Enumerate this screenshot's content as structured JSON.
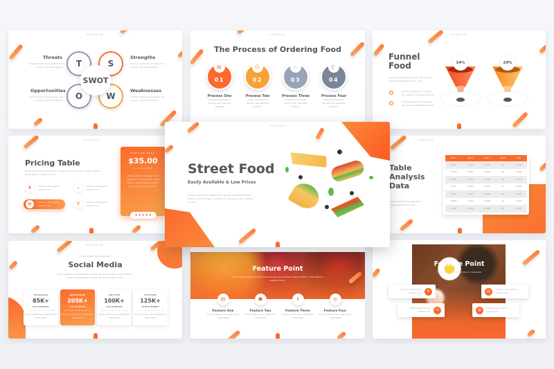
{
  "brand": "FEODLE",
  "lorem_short": "Vivamus elementum semper nisi. Aenean vulputate eleifend.",
  "lorem_long": "Vivamus elementum semper nisi. Aenean vulputate eleifend tellus. Aenean leo ligula, porttitor eu, consequat vitae, eleifend ac, enim.",
  "swot": {
    "center": "SWOT",
    "letters": {
      "t": "T",
      "s": "S",
      "o": "O",
      "w": "W"
    },
    "threats": "Threats",
    "strengths": "Strengths",
    "opportunities": "Opportunities",
    "weaknesses": "Weaknesses",
    "desc": "Vivamus elementum semper nisi. Aenean vulputate eleifend."
  },
  "process": {
    "title": "The Process of Ordering Food",
    "steps": [
      {
        "num": "01",
        "label": "Process One",
        "icon": "menu-icon",
        "color": "#fb6a2c"
      },
      {
        "num": "02",
        "label": "Process Two",
        "icon": "order-icon",
        "color": "#f9a03b"
      },
      {
        "num": "03",
        "label": "Process Three",
        "icon": "cooking-icon",
        "color": "#97a4b8"
      },
      {
        "num": "04",
        "label": "Process Four",
        "icon": "cutlery-icon",
        "color": "#7a8698"
      }
    ],
    "desc": "Vivamus elementum semper nisi vulputate eleifend."
  },
  "funnel": {
    "title_line1": "Funnel",
    "title_line2": "Food",
    "desc": "Vivamus elementum semper nisi. Aenean vulputate eleifend tellus in enim.",
    "items": [
      "Vivamus elementum semper nisi. Aenean vulputate eleifend.",
      "Vivamus elementum semper nisi. Aenean vulputate eleifend."
    ],
    "values": [
      {
        "pct": "34%",
        "color": "#fb5a2c"
      },
      {
        "pct": "29%",
        "color": "#f99a2c"
      }
    ]
  },
  "pricing": {
    "title": "Pricing Table",
    "desc": "Donec aliquet risus eget libero malesuada, quis pharetra magna efficitur. Nulla dapibus sagittis viverra.",
    "items": [
      {
        "icon": "cake-icon",
        "text": "Vivamus elementum semper nisi."
      },
      {
        "icon": "burger-icon",
        "text": "Vivamus elementum semper nisi."
      },
      {
        "icon": "receipt-icon",
        "text": "Vivamus elementum semper nisi.",
        "active": true
      },
      {
        "icon": "basket-icon",
        "text": "Vivamus elementum semper nisi."
      }
    ],
    "card": {
      "kicker": "POPULAR MENU",
      "price": "$35.00",
      "people": "3-4 PEOPLE",
      "desc": "Donec aliquet risus eget libero malesuada, quis pharetra magna efficitur. Nulla dapibus sagittis viverra. Sed lacinia risus vel.",
      "stars": "★★★★★",
      "rating": 5
    }
  },
  "cover": {
    "title": "Street Food",
    "subtitle": "Easily Available & Low Prices",
    "desc": "Vivamus elementum semper nisi. Aenean vulputate eleifend tellus. Aenean leo ligula, porttitor eu, consequat vitae, eleifend ac, enim."
  },
  "table": {
    "title_line1": "Table",
    "title_line2": "Analysis",
    "title_line3": "Data",
    "desc": "Donec aliquet risus eget libero malesuada efficitur nulla.",
    "headers": [
      "Data 1",
      "Data 2",
      "Data 3",
      "Result",
      "Total"
    ],
    "rows": [
      [
        "$3,850",
        "$2,049",
        "$1,650",
        "Yes",
        "$3,590"
      ],
      [
        "$1,649",
        "$4,050",
        "$1,649",
        "Yes",
        "$3,649"
      ],
      [
        "$1,649",
        "$4,050",
        "$1,649",
        "Yes",
        "$3,590"
      ],
      [
        "$2,731",
        "$1,050",
        "$4,050",
        "No",
        "$2,590"
      ],
      [
        "$1,649",
        "$4,050",
        "$1,649",
        "Yes",
        "$4,050"
      ],
      [
        "$1,649",
        "$4,050",
        "$1,649",
        "No",
        "$3,590"
      ],
      [
        "$1,649",
        "$4,050",
        "$1,649",
        "No",
        "$3,590"
      ]
    ]
  },
  "social": {
    "kicker": "Donec aliquet risus eget libero",
    "title": "Social Media",
    "desc": "Donec aliquet risus eget libero malesuada, quis pharetra magna efficitur. Nulla dapibus sagittis viverra. Sed lacinia risus vel est.",
    "cards": [
      {
        "platform": "FACEBOOK",
        "count": "85K+",
        "unit": "FOLLOWERS",
        "text": "Donec aliquet risus eget libero malesuada"
      },
      {
        "platform": "INSTAGRAM",
        "count": "205K+",
        "unit": "FOLLOWERS",
        "text": "Donec aliquet risus eget libero malesuada",
        "active": true
      },
      {
        "platform": "TWITTER",
        "count": "100K+",
        "unit": "FOLLOWERS",
        "text": "Donec aliquet risus eget libero malesuada"
      },
      {
        "platform": "YOUTUBE",
        "count": "125K+",
        "unit": "SUBSCRIBER",
        "text": "Donec aliquet risus eget libero malesuada"
      }
    ]
  },
  "features": {
    "title": "Feature Point",
    "desc": "Donec aliquet risus eget libero malesuada, quis pharetra magna efficitur. Nulla dapibus sagittis viverra.",
    "items": [
      {
        "label": "Feature One",
        "icon": "menu-icon",
        "text": "Donec aliquet risus eget libero malesuada"
      },
      {
        "label": "Feature Two",
        "icon": "burger-icon",
        "text": "Donec aliquet risus eget libero malesuada"
      },
      {
        "label": "Feature Three",
        "icon": "cutlery-icon",
        "text": "Donec aliquet risus eget libero malesuada"
      },
      {
        "label": "Feature Four",
        "icon": "plate-icon",
        "text": "Donec aliquet risus eget libero malesuada"
      }
    ]
  },
  "features2": {
    "title": "Feature Point",
    "desc": "Donec aliquet risus eget libero malesuada",
    "items": [
      {
        "icon": "basket-icon",
        "text": "Vivamus elementum semper nisi."
      },
      {
        "icon": "receipt-icon",
        "text": "Vivamus elementum semper nisi."
      },
      {
        "icon": "chef-icon",
        "text": "Vivamus elementum semper nisi."
      },
      {
        "icon": "menu-icon",
        "text": "Vivamus elementum semper nisi."
      }
    ]
  },
  "colors": {
    "accent": "#fb6a2c",
    "accent_light": "#f9a04e",
    "slate": "#8a9ab0",
    "text": "#555555"
  }
}
